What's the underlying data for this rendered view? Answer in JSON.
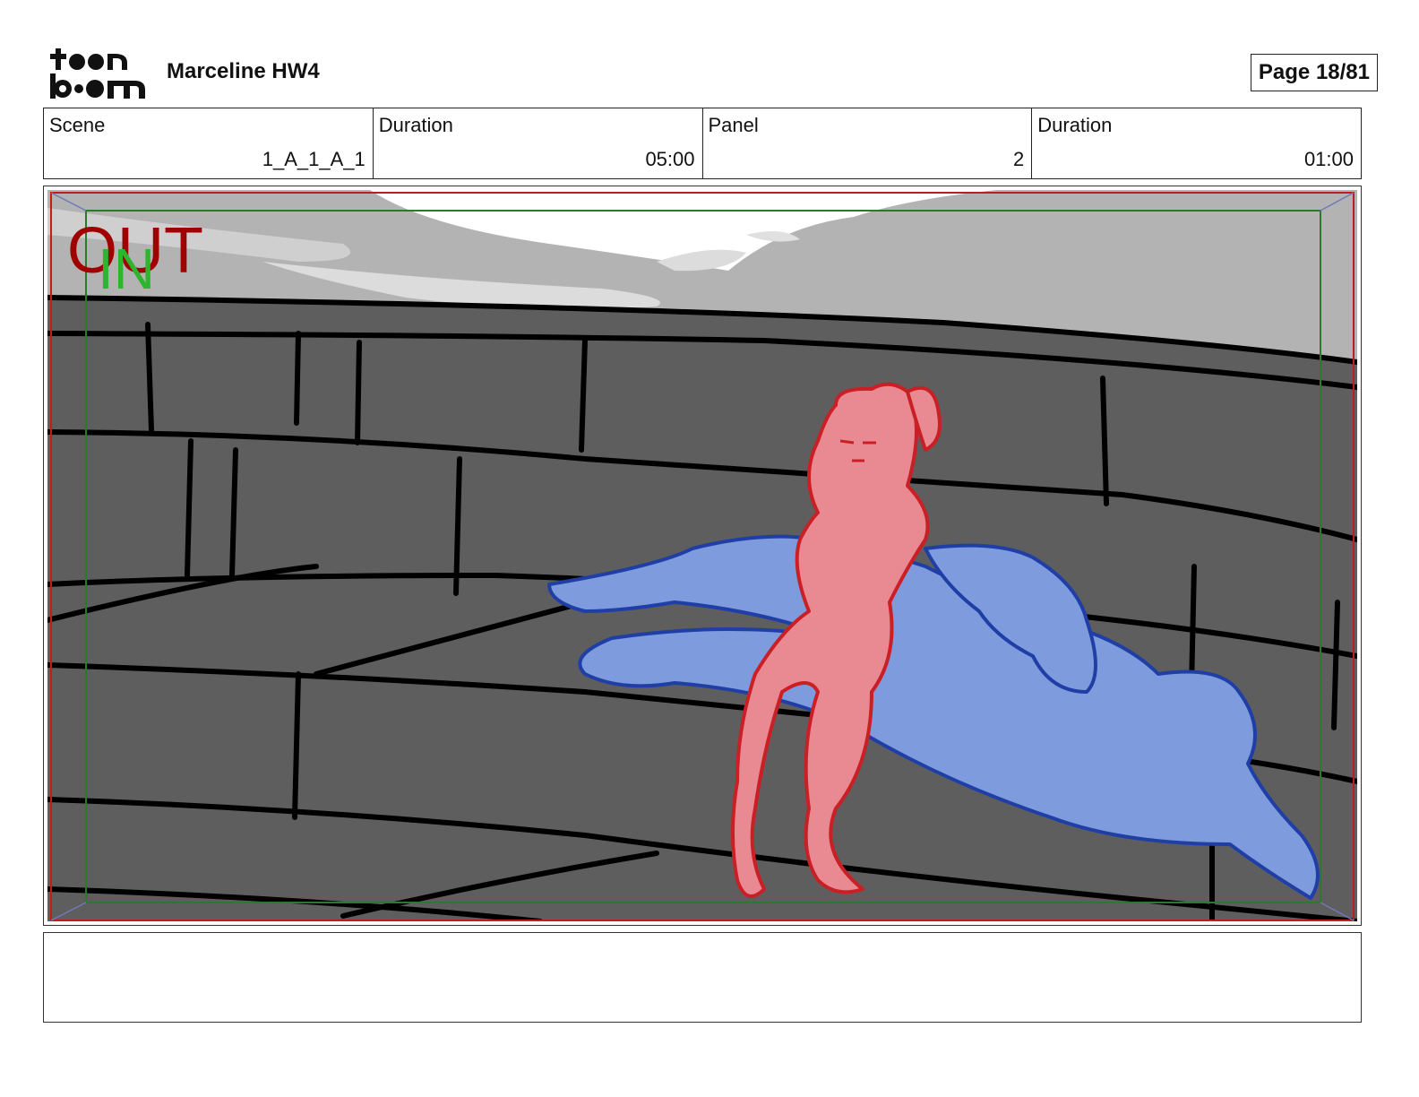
{
  "header": {
    "logo_text_top": "toon",
    "logo_text_bottom": "boom",
    "project_title": "Marceline HW4",
    "page_indicator": "Page 18/81"
  },
  "info": {
    "scene_label": "Scene",
    "scene_value": "1_A_1_A_1",
    "scene_duration_label": "Duration",
    "scene_duration_value": "05:00",
    "panel_label": "Panel",
    "panel_value": "2",
    "panel_duration_label": "Duration",
    "panel_duration_value": "01:00"
  },
  "frame_markers": {
    "out_label": "OUT",
    "in_label": "IN",
    "out_color": "#a00000",
    "in_color": "#2db52d"
  },
  "notes": {
    "text": ""
  }
}
